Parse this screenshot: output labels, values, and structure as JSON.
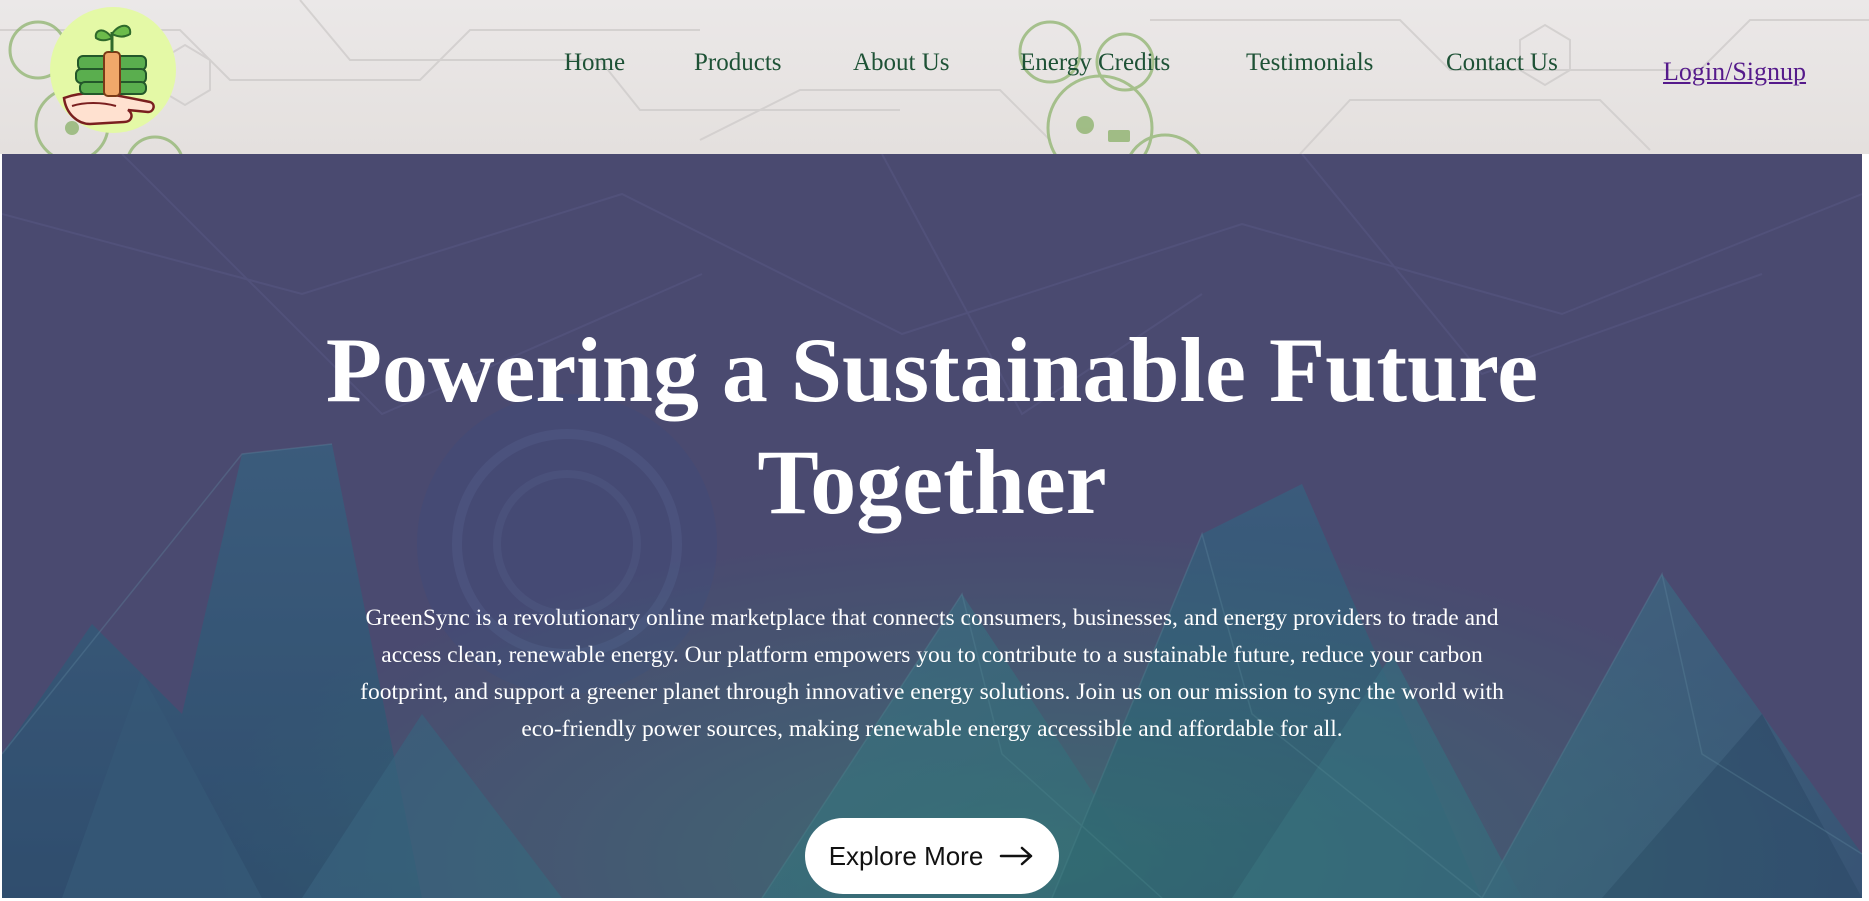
{
  "brand": {
    "logo_icon": "plant-on-hand-logo-icon",
    "logo_bg_color": "#e4f9a6"
  },
  "nav": {
    "items": [
      {
        "label": "Home"
      },
      {
        "label": "Products"
      },
      {
        "label": "About Us"
      },
      {
        "label": "Energy Credits"
      },
      {
        "label": "Testimonials"
      },
      {
        "label": "Contact Us"
      }
    ],
    "login_label": "Login/Signup",
    "link_color": "#1e5236",
    "login_color": "#551a8b"
  },
  "hero": {
    "title_line1": "Powering a Sustainable Future",
    "title_line2": "Together",
    "description": "GreenSync is a revolutionary online marketplace that connects consumers, businesses, and energy providers to trade and access clean, renewable energy. Our platform empowers you to contribute to a sustainable future, reduce your carbon footprint, and support a greener planet through innovative energy solutions. Join us on our mission to sync the world with eco-friendly power sources, making renewable energy accessible and affordable for all.",
    "cta_label": "Explore More",
    "cta_icon": "arrow-right-icon",
    "overlay_color": "#4a4a70"
  }
}
